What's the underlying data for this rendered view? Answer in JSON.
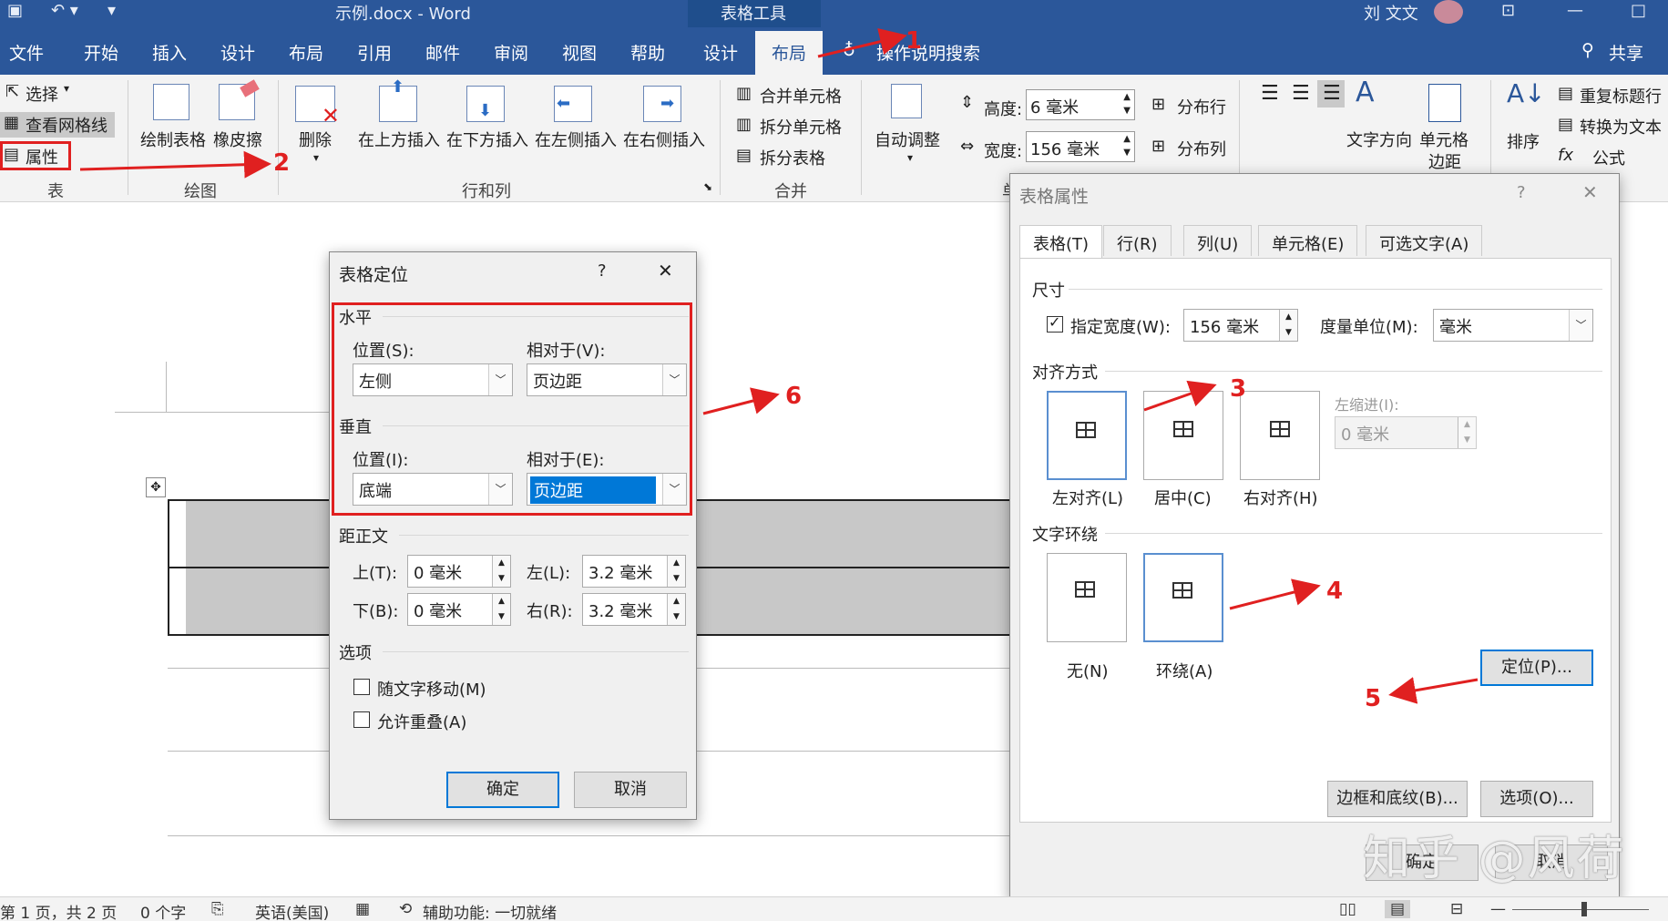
{
  "titlebar": {
    "doc_title": "示例.docx  -  Word",
    "context_tools": "表格工具",
    "user": "刘 文文"
  },
  "tabs": [
    "文件",
    "开始",
    "插入",
    "设计",
    "布局",
    "引用",
    "邮件",
    "审阅",
    "视图",
    "帮助",
    "设计",
    "布局"
  ],
  "search_hint": "操作说明搜索",
  "share": "共享",
  "ribbon": {
    "select": "选择",
    "gridlines": "查看网格线",
    "properties": "属性",
    "group_table": "表",
    "draw_table": "绘制表格",
    "eraser": "橡皮擦",
    "group_draw": "绘图",
    "delete": "删除",
    "insert_above": "在上方插入",
    "insert_below": "在下方插入",
    "insert_left": "在左侧插入",
    "insert_right": "在右侧插入",
    "group_rowscols": "行和列",
    "merge_cells": "合并单元格",
    "split_cells": "拆分单元格",
    "split_table": "拆分表格",
    "group_merge": "合并",
    "autofit": "自动调整",
    "height_label": "高度:",
    "height_value": "6 毫米",
    "width_label": "宽度:",
    "width_value": "156 毫米",
    "distribute_rows": "分布行",
    "distribute_cols": "分布列",
    "group_cellsize_partial": "单",
    "text_direction": "文字方向",
    "cell_margins": "单元格\n边距",
    "cell_margins_l1": "单元格",
    "cell_margins_l2": "边距",
    "sort": "排序",
    "repeat_header": "重复标题行",
    "convert_text": "转换为文本",
    "formula": "公式"
  },
  "dialog_pos": {
    "title": "表格定位",
    "help": "?",
    "close": "✕",
    "horizontal": "水平",
    "h_pos_label": "位置(S):",
    "h_pos_value": "左侧",
    "h_rel_label": "相对于(V):",
    "h_rel_value": "页边距",
    "vertical": "垂直",
    "v_pos_label": "位置(I):",
    "v_pos_value": "底端",
    "v_rel_label": "相对于(E):",
    "v_rel_value": "页边距",
    "distance": "距正文",
    "top_label": "上(T):",
    "top_value": "0 毫米",
    "left_label": "左(L):",
    "left_value": "3.2 毫米",
    "bottom_label": "下(B):",
    "bottom_value": "0 毫米",
    "right_label": "右(R):",
    "right_value": "3.2 毫米",
    "options": "选项",
    "move_with_text": "随文字移动(M)",
    "allow_overlap": "允许重叠(A)",
    "ok": "确定",
    "cancel": "取消"
  },
  "dialog_props": {
    "title": "表格属性",
    "help": "?",
    "close": "✕",
    "tabs": [
      "表格(T)",
      "行(R)",
      "列(U)",
      "单元格(E)",
      "可选文字(A)"
    ],
    "size": "尺寸",
    "pref_width": "指定宽度(W):",
    "width_value": "156 毫米",
    "unit_label": "度量单位(M):",
    "unit_value": "毫米",
    "alignment": "对齐方式",
    "align_left": "左对齐(L)",
    "align_center": "居中(C)",
    "align_right": "右对齐(H)",
    "indent_label": "左缩进(I):",
    "indent_value": "0 毫米",
    "wrapping": "文字环绕",
    "wrap_none": "无(N)",
    "wrap_around": "环绕(A)",
    "positioning": "定位(P)...",
    "borders": "边框和底纹(B)...",
    "options": "选项(O)...",
    "ok": "确定",
    "cancel": "取消"
  },
  "annotations": [
    "1",
    "2",
    "3",
    "4",
    "5",
    "6"
  ],
  "watermark": "知乎 @风荷",
  "statusbar": {
    "page": "第 1 页，共 2 页",
    "words": "0 个字",
    "lang": "英语(美国)",
    "accessibility": "辅助功能: 一切就绪"
  },
  "colors": {
    "word_blue": "#2b579a",
    "annotation_red": "#e02020",
    "selection_blue": "#0078d7"
  }
}
